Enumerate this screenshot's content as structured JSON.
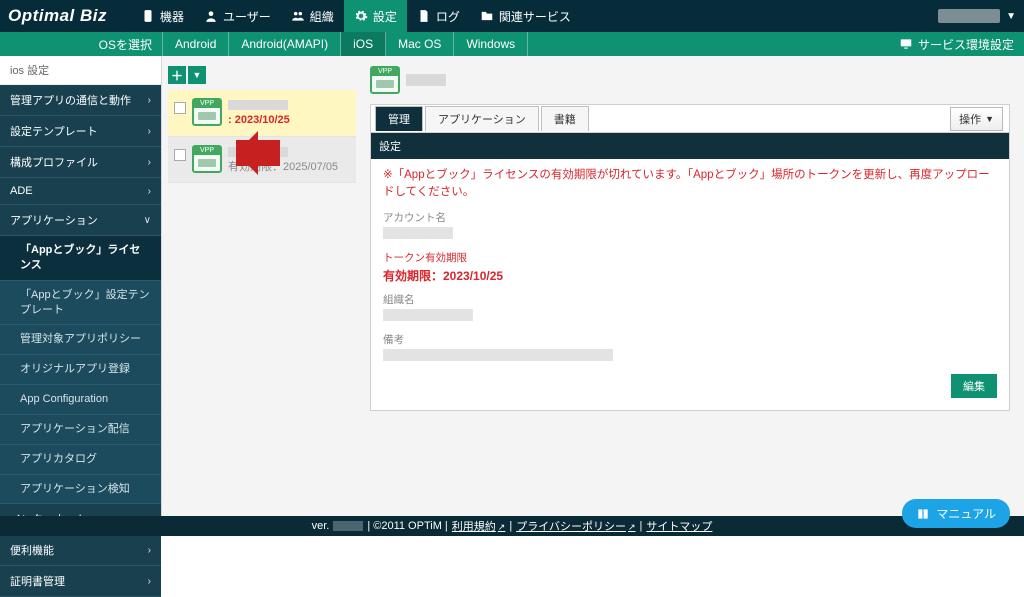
{
  "brand": "Optimal Biz",
  "header": {
    "items": [
      {
        "icon": "device",
        "label": "機器"
      },
      {
        "icon": "user",
        "label": "ユーザー"
      },
      {
        "icon": "group",
        "label": "組織"
      },
      {
        "icon": "gear",
        "label": "設定",
        "active": true
      },
      {
        "icon": "doc",
        "label": "ログ"
      },
      {
        "icon": "folder",
        "label": "関連サービス"
      }
    ]
  },
  "subheader": {
    "left": "OSを選択",
    "tabs": [
      "Android",
      "Android(AMAPI)",
      "iOS",
      "Mac OS",
      "Windows"
    ],
    "active": "iOS",
    "right": "サービス環境設定"
  },
  "sidebar": {
    "title": "ios 設定",
    "groups": [
      {
        "label": "管理アプリの通信と動作",
        "type": "sec",
        "chev": "›"
      },
      {
        "label": "設定テンプレート",
        "type": "sec",
        "chev": "›"
      },
      {
        "label": "構成プロファイル",
        "type": "sec",
        "chev": "›"
      },
      {
        "label": "ADE",
        "type": "sec",
        "chev": "›"
      },
      {
        "label": "アプリケーション",
        "type": "sec",
        "chev": "∨",
        "open": true
      },
      {
        "label": "「Appとブック」ライセンス",
        "type": "sub",
        "active": true
      },
      {
        "label": "「Appとブック」設定テンプレート",
        "type": "sub"
      },
      {
        "label": "管理対象アプリポリシー",
        "type": "sub"
      },
      {
        "label": "オリジナルアプリ登録",
        "type": "sub"
      },
      {
        "label": "App Configuration",
        "type": "sub"
      },
      {
        "label": "アプリケーション配信",
        "type": "sub"
      },
      {
        "label": "アプリカタログ",
        "type": "sub"
      },
      {
        "label": "アプリケーション検知",
        "type": "sub"
      },
      {
        "label": "インターネット",
        "type": "sec",
        "chev": "›"
      },
      {
        "label": "便利機能",
        "type": "sec",
        "chev": "›"
      },
      {
        "label": "証明書管理",
        "type": "sec",
        "chev": "›"
      }
    ]
  },
  "list": {
    "items": [
      {
        "expiry_label": ": 2023/10/25",
        "expired": true
      },
      {
        "expiry_label": "有効期限：2025/07/05",
        "expired": false
      }
    ]
  },
  "detail": {
    "tabs": [
      "管理",
      "アプリケーション",
      "書籍"
    ],
    "activeTab": "管理",
    "ops": "操作",
    "title": "設定",
    "warning": "※「Appとブック」ライセンスの有効期限が切れています。「Appとブック」場所のトークンを更新し、再度アップロードしてください。",
    "fields": {
      "account": "アカウント名",
      "token": "トークン有効期限",
      "token_value": "有効期限：2023/10/25",
      "org": "組織名",
      "note": "備考"
    },
    "edit": "編集"
  },
  "footer": {
    "ver": "ver.",
    "copyright": "| ©2011 OPTiM |",
    "links": [
      "利用規約",
      "プライバシーポリシー",
      "サイトマップ"
    ]
  },
  "manual": "マニュアル"
}
